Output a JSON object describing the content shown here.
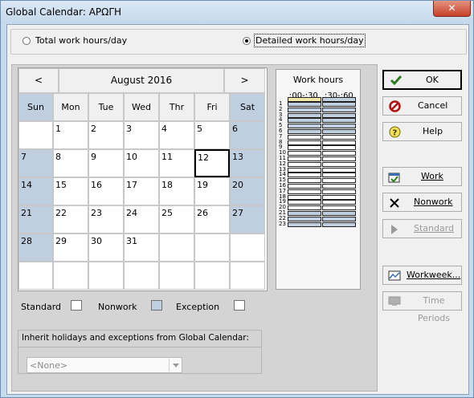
{
  "window": {
    "title": "Global Calendar: ΑΡΩΓΗ",
    "close_label": "✕"
  },
  "mode": {
    "total_label": "Total work hours/day",
    "detailed_label": "Detailed work hours/day",
    "selected": "detailed"
  },
  "calendar": {
    "prev_label": "<",
    "next_label": ">",
    "month_label": "August 2016",
    "weekdays": [
      "Sun",
      "Mon",
      "Tue",
      "Wed",
      "Thr",
      "Fri",
      "Sat"
    ],
    "weeks": [
      [
        "",
        "1",
        "2",
        "3",
        "4",
        "5",
        "6"
      ],
      [
        "7",
        "8",
        "9",
        "10",
        "11",
        "12",
        "13"
      ],
      [
        "14",
        "15",
        "16",
        "17",
        "18",
        "19",
        "20"
      ],
      [
        "21",
        "22",
        "23",
        "24",
        "25",
        "26",
        "27"
      ],
      [
        "28",
        "29",
        "30",
        "31",
        "",
        "",
        ""
      ],
      [
        "",
        "",
        "",
        "",
        "",
        "",
        ""
      ]
    ],
    "selected_day": "12"
  },
  "work_hours": {
    "title": "Work hours",
    "col1": ":00-:30",
    "col2": ":30-:60",
    "hours": [
      "1",
      "2",
      "3",
      "4",
      "5",
      "6",
      "7",
      "8",
      "9",
      "10",
      "11",
      "12",
      "13",
      "14",
      "15",
      "16",
      "17",
      "18",
      "19",
      "20",
      "21",
      "22",
      "23"
    ],
    "work_color": "#bfcfe0",
    "nonwork_color": "#ffffff",
    "highlight_color": "#f0e6a6"
  },
  "legend": {
    "standard": "Standard",
    "nonwork": "Nonwork",
    "exception": "Exception"
  },
  "inherit": {
    "label": "Inherit holidays and exceptions from Global Calendar:",
    "value": "<None>"
  },
  "buttons": {
    "ok": "OK",
    "cancel": "Cancel",
    "help": "Help",
    "work": "Work",
    "nonwork": "Nonwork",
    "standard": "Standard",
    "workweek": "Workweek...",
    "time_periods": "Time Periods"
  },
  "colors": {
    "weekend": "#bfcfe0",
    "accent": "#2f7d1e",
    "danger": "#b01010",
    "help": "#c8b000"
  }
}
